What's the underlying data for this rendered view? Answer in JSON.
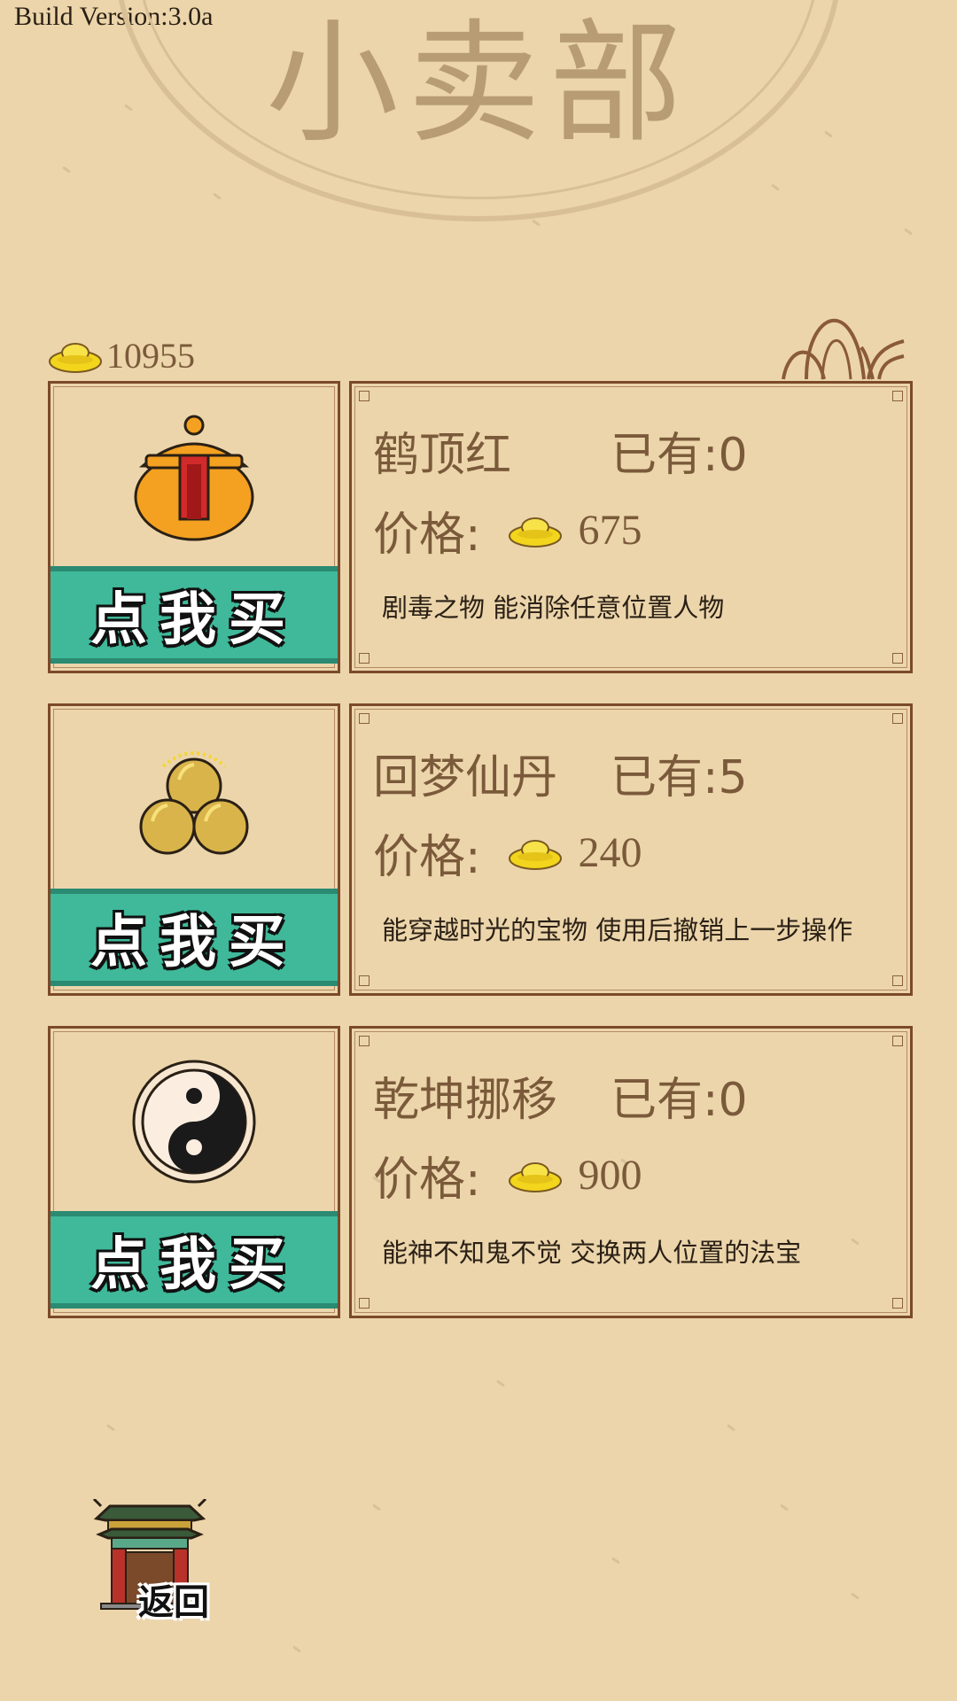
{
  "build_version": "Build Version:3.0a",
  "page_title": "小卖部",
  "currency": {
    "icon": "gold-ingot-icon",
    "amount": "10955"
  },
  "items": [
    {
      "name": "鹤顶红",
      "owned": "已有:0",
      "price_label": "价格:",
      "price": "675",
      "description": "剧毒之物 能消除任意位置人物",
      "buy_label": "点我买",
      "icon": "poison-jar-icon"
    },
    {
      "name": "回梦仙丹",
      "owned": "已有:5",
      "price_label": "价格:",
      "price": "240",
      "description": "能穿越时光的宝物 使用后撤销上一步操作",
      "buy_label": "点我买",
      "icon": "golden-pills-icon"
    },
    {
      "name": "乾坤挪移",
      "owned": "已有:0",
      "price_label": "价格:",
      "price": "900",
      "description": "能神不知鬼不觉 交换两人位置的法宝",
      "buy_label": "点我买",
      "icon": "yin-yang-icon"
    }
  ],
  "back_button": {
    "label": "返回",
    "icon": "gate-icon"
  },
  "colors": {
    "background": "#ecd5ab",
    "button": "#3fb99a",
    "border": "#7b4a2a",
    "text": "#7a5a3a"
  }
}
